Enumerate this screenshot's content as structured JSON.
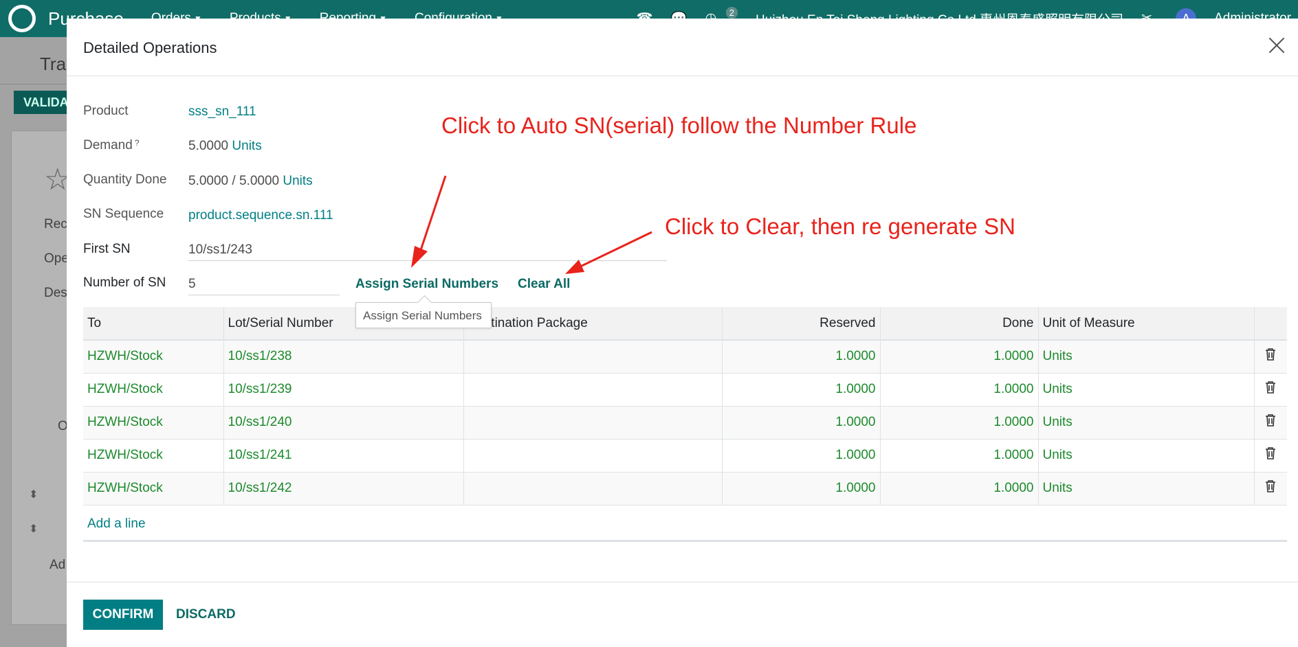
{
  "navbar": {
    "app": "Purchase",
    "menus": [
      "Orders",
      "Products",
      "Reporting",
      "Configuration"
    ],
    "activity_count": "2",
    "company": "Huizhou En Tai Sheng Lighting Co.Ltd 惠州恩泰盛照明有限公司",
    "user": "Administrator",
    "user_initial": "A"
  },
  "background": {
    "title_partial": "Tra",
    "validate_partial": "VALIDA",
    "label_1": "Rec",
    "label_2": "Ope",
    "label_3": "Des",
    "add_partial": "Ad",
    "tab_partial": "O"
  },
  "modal": {
    "title": "Detailed Operations",
    "fields": {
      "product_label": "Product",
      "product_value": "sss_sn_111",
      "demand_label": "Demand",
      "demand_required": "?",
      "demand_qty": "5.0000",
      "demand_uom": "Units",
      "qty_done_label": "Quantity Done",
      "qty_done_value": "5.0000",
      "qty_done_sep": "/",
      "qty_done_total": "5.0000",
      "qty_done_uom": "Units",
      "sn_sequence_label": "SN Sequence",
      "sn_sequence_value": "product.sequence.sn.111",
      "first_sn_label": "First SN",
      "first_sn_value": "10/ss1/243",
      "number_sn_label": "Number of SN",
      "number_sn_value": "5"
    },
    "assign_button": "Assign Serial Numbers",
    "clear_button": "Clear All",
    "tooltip": "Assign Serial Numbers",
    "table": {
      "columns": [
        "To",
        "Lot/Serial Number",
        "Destination Package",
        "Reserved",
        "Done",
        "Unit of Measure"
      ],
      "rows": [
        {
          "to": "HZWH/Stock",
          "lot": "10/ss1/238",
          "pkg": "",
          "reserved": "1.0000",
          "done": "1.0000",
          "uom": "Units"
        },
        {
          "to": "HZWH/Stock",
          "lot": "10/ss1/239",
          "pkg": "",
          "reserved": "1.0000",
          "done": "1.0000",
          "uom": "Units"
        },
        {
          "to": "HZWH/Stock",
          "lot": "10/ss1/240",
          "pkg": "",
          "reserved": "1.0000",
          "done": "1.0000",
          "uom": "Units"
        },
        {
          "to": "HZWH/Stock",
          "lot": "10/ss1/241",
          "pkg": "",
          "reserved": "1.0000",
          "done": "1.0000",
          "uom": "Units"
        },
        {
          "to": "HZWH/Stock",
          "lot": "10/ss1/242",
          "pkg": "",
          "reserved": "1.0000",
          "done": "1.0000",
          "uom": "Units"
        }
      ],
      "add_line": "Add a line"
    },
    "confirm": "CONFIRM",
    "discard": "DISCARD"
  },
  "annotations": {
    "auto_sn": "Click to Auto SN(serial) follow the Number Rule",
    "clear": "Click to Clear, then re generate SN",
    "color": "#e8231c"
  },
  "colors": {
    "brand": "#106c66",
    "link": "#017e84",
    "table_text": "#1c8a2c"
  }
}
